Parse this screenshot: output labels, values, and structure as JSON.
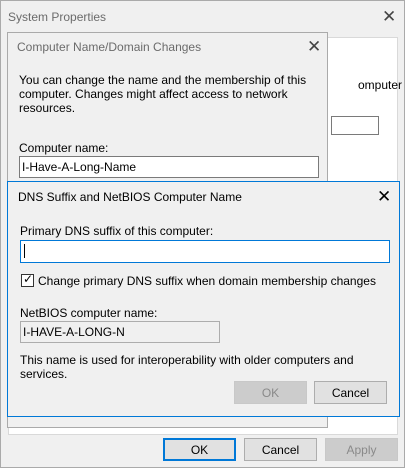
{
  "system_properties": {
    "title": "System Properties",
    "text_right": "omputer",
    "ok_label": "OK",
    "cancel_label": "Cancel",
    "apply_label": "Apply"
  },
  "computer_name_dialog": {
    "title": "Computer Name/Domain Changes",
    "description": "You can change the name and the membership of this computer. Changes might affect access to network resources.",
    "computer_name_label": "Computer name:",
    "computer_name_value": "I-Have-A-Long-Name"
  },
  "dns_dialog": {
    "title": "DNS Suffix and NetBIOS Computer Name",
    "primary_suffix_label": "Primary DNS suffix of this computer:",
    "primary_suffix_value": "",
    "checkbox_label": "Change primary DNS suffix when domain membership changes",
    "checkbox_checked": true,
    "netbios_label": "NetBIOS computer name:",
    "netbios_value": "I-HAVE-A-LONG-N",
    "note": "This name is used for interoperability with older computers and services.",
    "ok_label": "OK",
    "cancel_label": "Cancel"
  },
  "icons": {
    "close": "close-icon",
    "check": "check-icon"
  },
  "colors": {
    "accent": "#0078d7",
    "window": "#f0f0f0",
    "border": "#aaaaaa"
  }
}
